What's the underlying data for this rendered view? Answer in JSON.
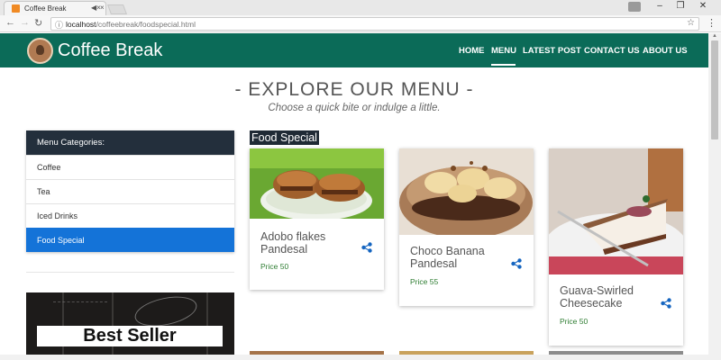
{
  "browser": {
    "tab_title": "Coffee Break",
    "url_host": "localhost",
    "url_path": "/coffeebreak/foodspecial.html",
    "close_glyph": "×",
    "audio_glyph": "◀×",
    "win_min": "–",
    "win_max": "❐",
    "win_close": "✕"
  },
  "header": {
    "brand": "Coffee Break",
    "nav": [
      "HOME",
      "MENU",
      "LATEST POST",
      "CONTACT US",
      "ABOUT US"
    ],
    "active_nav": "MENU",
    "color": "#0b6b58"
  },
  "main": {
    "heading": "- EXPLORE OUR MENU -",
    "subheading": "Choose a quick bite or indulge a little."
  },
  "sidebar": {
    "header": "Menu Categories:",
    "items": [
      "Coffee",
      "Tea",
      "Iced Drinks",
      "Food Special"
    ],
    "active": "Food Special",
    "banner": "Best Seller",
    "accent": "#1473d8"
  },
  "section": {
    "title": "Food Special",
    "cards": [
      {
        "name_line1": "Adobo flakes",
        "name_line2": "Pandesal",
        "price": "Price 50"
      },
      {
        "name_line1": "Choco Banana",
        "name_line2": "Pandesal",
        "price": "Price 55"
      },
      {
        "name_line1": "Guava-Swirled",
        "name_line2": "Cheesecake",
        "price": "Price 50"
      }
    ],
    "share_icon": "share-icon",
    "price_color": "#2e7d32"
  }
}
